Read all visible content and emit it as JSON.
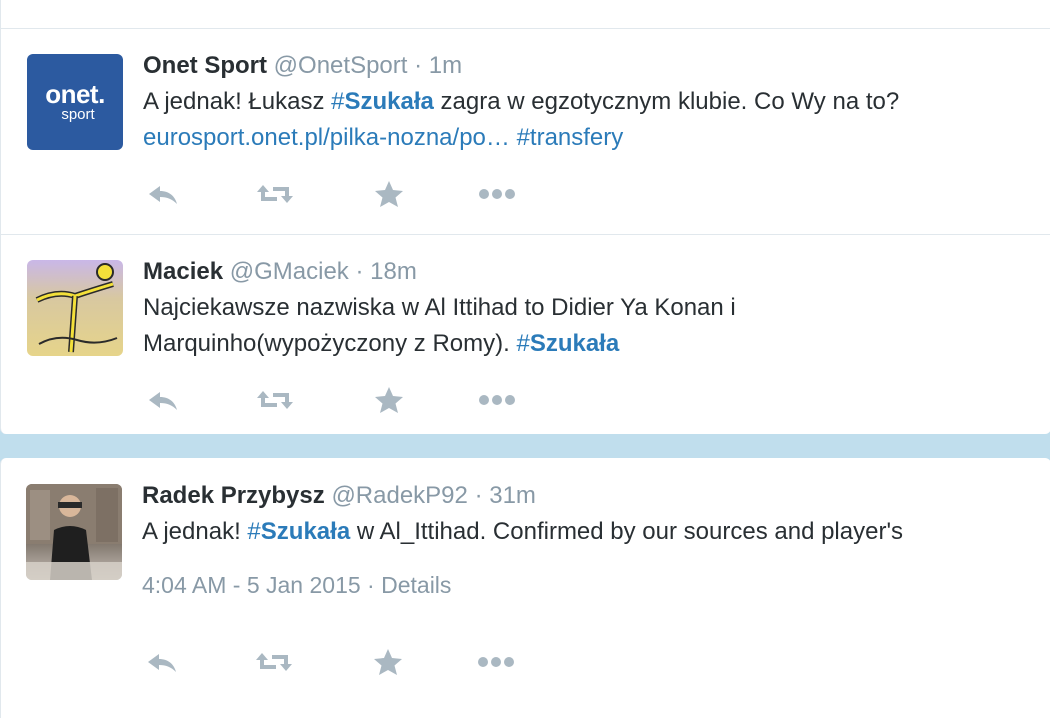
{
  "colors": {
    "link": "#2b7bb9",
    "muted": "#8899a6",
    "icon": "#aab8c2",
    "background": "#c0deed"
  },
  "tweets": [
    {
      "name": "Onet Sport",
      "handle": "@OnetSport",
      "dot": "·",
      "time": "1m",
      "avatar": {
        "brand": "onet.",
        "sub": "sport"
      },
      "line1_a": "A jednak! Łukasz ",
      "hash1_sym": "#",
      "hash1_word": "Szukała",
      "line1_b": " zagra w egzotycznym klubie. Co Wy na to?",
      "link": "eurosport.onet.pl/pilka-nozna/po…",
      "hash2": "#transfery"
    },
    {
      "name": "Maciek",
      "handle": "@GMaciek",
      "dot": "·",
      "time": "18m",
      "line1": "Najciekawsze nazwiska w Al Ittihad to Didier Ya Konan i",
      "line2_a": "Marquinho(wypożyczony z Romy). ",
      "hash_sym": "#",
      "hash_word": "Szukała"
    },
    {
      "name": "Radek Przybysz",
      "handle": "@RadekP92",
      "dot": "·",
      "time": "31m",
      "line1_a": "A jednak! ",
      "hash_sym": "#",
      "hash_word": "Szukała",
      "line1_b": " w Al_Ittihad. Confirmed by our sources and player's",
      "timestamp": "4:04 AM - 5 Jan 2015",
      "meta_dot": "·",
      "details": "Details"
    }
  ],
  "action_icons": [
    "reply-icon",
    "retweet-icon",
    "favorite-icon",
    "more-icon"
  ]
}
